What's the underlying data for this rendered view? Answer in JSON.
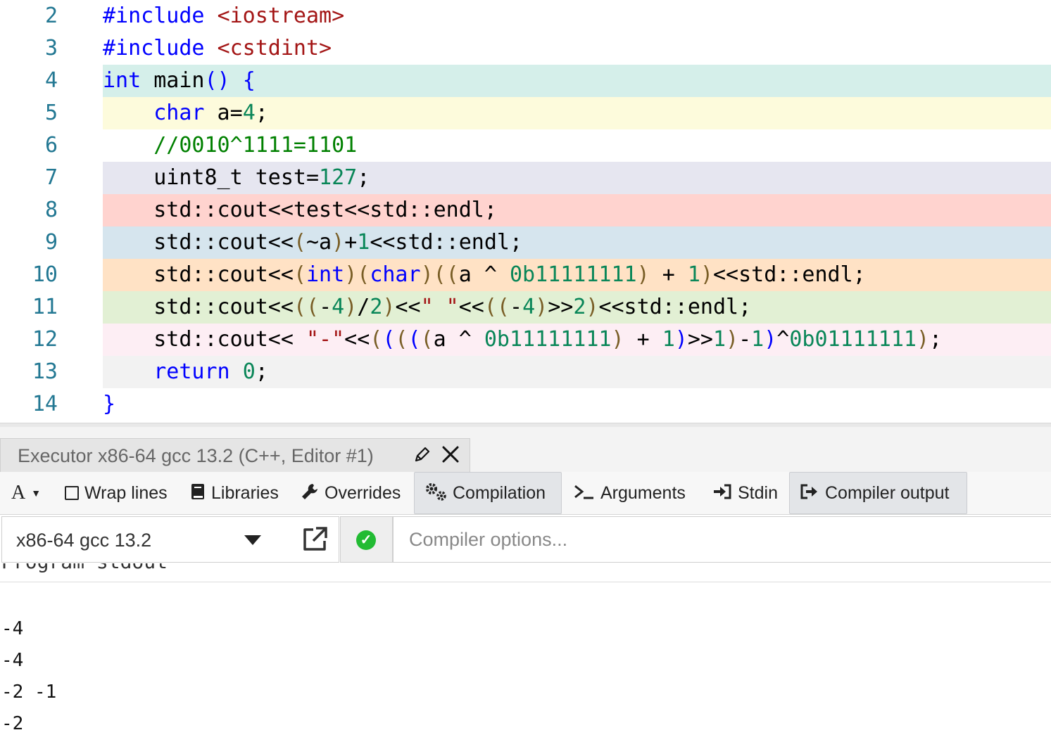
{
  "editor": {
    "lines": [
      {
        "no": "2",
        "code": "#include <iostream>"
      },
      {
        "no": "3",
        "code": "#include <cstdint>"
      },
      {
        "no": "4",
        "code": "int main() {"
      },
      {
        "no": "5",
        "code": "    char a=4;"
      },
      {
        "no": "6",
        "code": "    //0010^1111=1101"
      },
      {
        "no": "7",
        "code": "    uint8_t test=127;"
      },
      {
        "no": "8",
        "code": "    std::cout<<test<<std::endl;"
      },
      {
        "no": "9",
        "code": "    std::cout<<(~a)+1<<std::endl;"
      },
      {
        "no": "10",
        "code": "    std::cout<<(int)(char)((a ^ 0b11111111) + 1)<<std::endl;"
      },
      {
        "no": "11",
        "code": "    std::cout<<((-4)/2)<<\" \"<<((-4)>>2)<<std::endl;"
      },
      {
        "no": "12",
        "code": "    std::cout<< \"-\"<<(((((a ^ 0b11111111) + 1)>>1)-1)^0b01111111);"
      },
      {
        "no": "13",
        "code": "    return 0;"
      },
      {
        "no": "14",
        "code": "}"
      }
    ],
    "highlight_colors": [
      "#d5efea",
      "#fdfbdc",
      "#ffffff",
      "#e6e6f0",
      "#ffd3cf",
      "#d6e5ee",
      "#ffe2c5",
      "#e2f0d4",
      "#fdeef4",
      "#f2f2f2"
    ]
  },
  "pane": {
    "title": "Executor x86-64 gcc 13.2 (C++, Editor #1)",
    "edit_icon": "pencil-icon",
    "close_icon": "close-icon"
  },
  "toolbar": {
    "font_label": "A",
    "wrap_label": "Wrap lines",
    "libraries_label": "Libraries",
    "overrides_label": "Overrides",
    "compilation_label": "Compilation",
    "arguments_label": "Arguments",
    "stdin_label": "Stdin",
    "compiler_output_label": "Compiler output"
  },
  "compiler": {
    "name": "x86-64 gcc 13.2",
    "options_placeholder": "Compiler options...",
    "status": "success",
    "status_color": "#22bb33"
  },
  "output": {
    "heading": "Program stdout",
    "lines": [
      "-4",
      "-4",
      "-2 -1",
      "-2"
    ]
  }
}
